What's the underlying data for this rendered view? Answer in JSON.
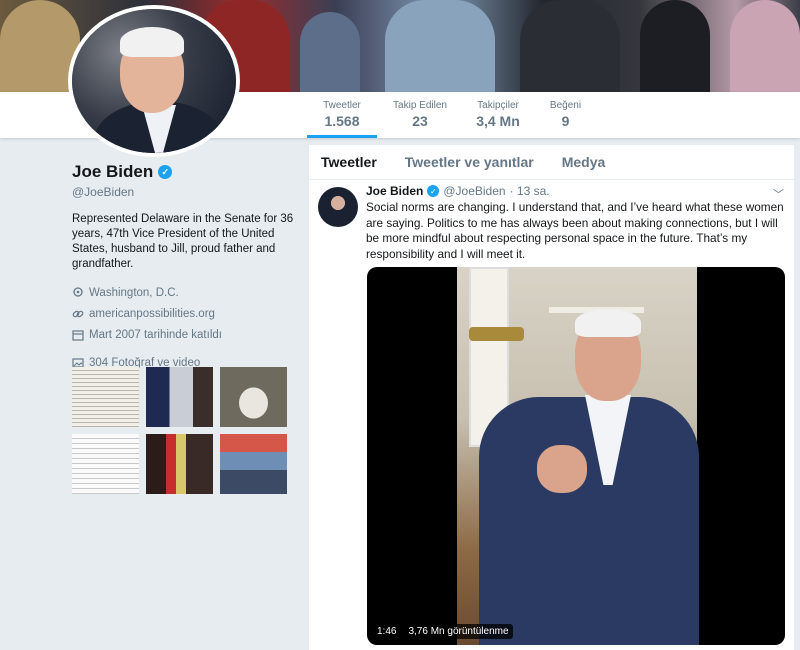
{
  "nav": {
    "stats": [
      {
        "label": "Tweetler",
        "value": "1.568"
      },
      {
        "label": "Takip Edilen",
        "value": "23"
      },
      {
        "label": "Takipçiler",
        "value": "3,4 Mn"
      },
      {
        "label": "Beğeni",
        "value": "9"
      }
    ]
  },
  "profile": {
    "name": "Joe Biden",
    "handle": "@JoeBiden",
    "bio": "Represented Delaware in the Senate for 36 years, 47th Vice President of the United States, husband to Jill, proud father and grandfather.",
    "location": "Washington, D.C.",
    "website": "americanpossibilities.org",
    "joined": "Mart 2007 tarihinde katıldı",
    "photos_label": "304 Fotoğraf ve video"
  },
  "timeline": {
    "tabs": [
      "Tweetler",
      "Tweetler ve yanıtlar",
      "Medya"
    ]
  },
  "tweet": {
    "name": "Joe Biden",
    "handle": "@JoeBiden",
    "time": "· 13 sa.",
    "text": "Social norms are changing. I understand that, and I’ve heard what these women are saying. Politics to me has always been about making connections, but I will be more mindful about respecting personal space in the future. That’s my responsibility and I will meet it.",
    "video_duration": "1:46",
    "video_views": "3,76 Mn görüntülenme"
  },
  "colors": {
    "accent": "#1da1f2",
    "background": "#e6ecf0",
    "muted_text": "#657786"
  }
}
